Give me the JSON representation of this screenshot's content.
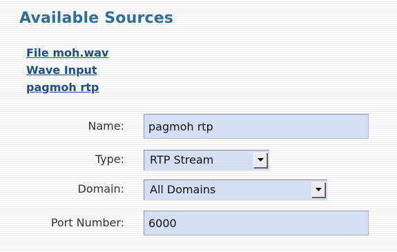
{
  "title": "Available Sources",
  "sources": [
    {
      "label": "File moh.wav"
    },
    {
      "label": "Wave Input"
    },
    {
      "label": "pagmoh rtp"
    }
  ],
  "form": {
    "name": {
      "label": "Name:",
      "value": "pagmoh rtp"
    },
    "type": {
      "label": "Type:",
      "value": "RTP Stream",
      "dropdown_icon": "chevron-down-icon"
    },
    "domain": {
      "label": "Domain:",
      "value": "All Domains",
      "dropdown_icon": "chevron-down-icon"
    },
    "port": {
      "label": "Port Number:",
      "value": "6000"
    }
  },
  "colors": {
    "title": "#2e6e98",
    "link": "#1d4f8a",
    "field_background": "#d5def3"
  }
}
